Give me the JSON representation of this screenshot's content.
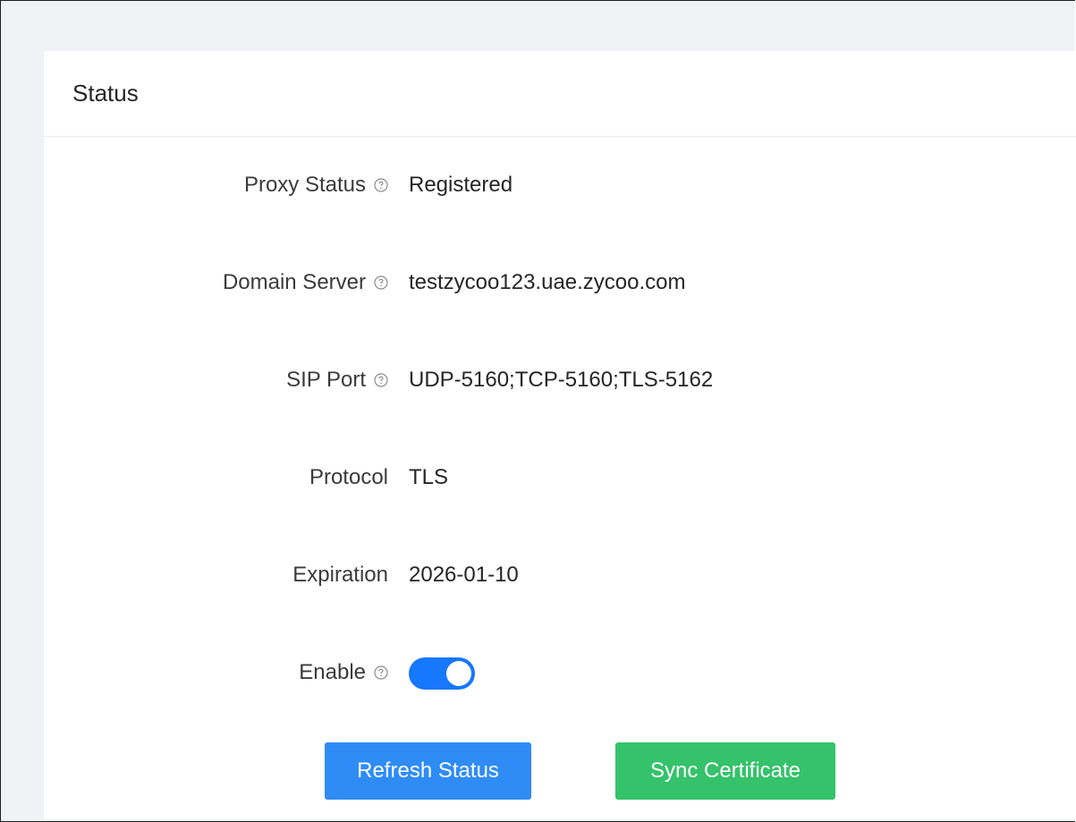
{
  "card": {
    "title": "Status"
  },
  "fields": {
    "proxy_status": {
      "label": "Proxy Status",
      "value": "Registered"
    },
    "domain_server": {
      "label": "Domain Server",
      "value": "testzycoo123.uae.zycoo.com"
    },
    "sip_port": {
      "label": "SIP Port",
      "value": "UDP-5160;TCP-5160;TLS-5162"
    },
    "protocol": {
      "label": "Protocol",
      "value": "TLS"
    },
    "expiration": {
      "label": "Expiration",
      "value": "2026-01-10"
    },
    "enable": {
      "label": "Enable",
      "checked": true
    }
  },
  "buttons": {
    "refresh_label": "Refresh Status",
    "sync_label": "Sync Certificate"
  },
  "colors": {
    "switch_on": "#1677ff",
    "refresh_button": "#2f8cf7",
    "sync_button": "#34c26a"
  },
  "icons": {
    "help": "question-circle-icon"
  }
}
